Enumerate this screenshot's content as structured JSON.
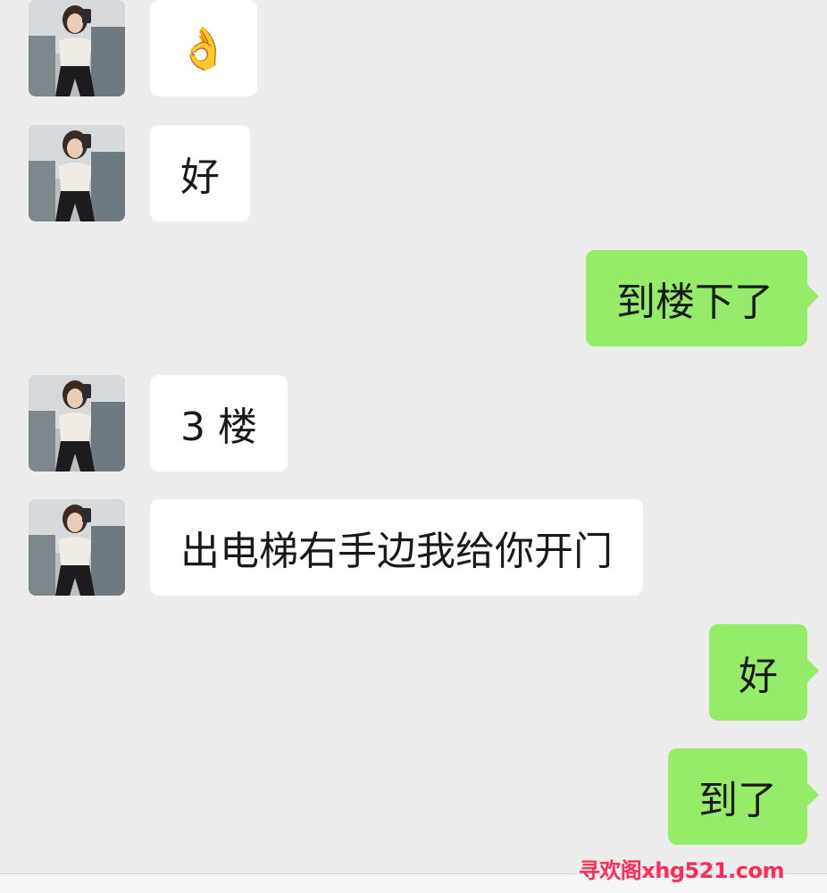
{
  "colors": {
    "background": "#ededed",
    "incoming_bubble": "#ffffff",
    "outgoing_bubble": "#95ec69",
    "text": "#191919",
    "watermark": "#ff2d55"
  },
  "messages": [
    {
      "direction": "incoming",
      "avatar": "contact-avatar-photo",
      "text": "👌"
    },
    {
      "direction": "incoming",
      "avatar": "contact-avatar-photo",
      "text": "好"
    },
    {
      "direction": "outgoing",
      "text": "到楼下了"
    },
    {
      "direction": "incoming",
      "avatar": "contact-avatar-photo",
      "text": "3 楼"
    },
    {
      "direction": "incoming",
      "avatar": "contact-avatar-photo",
      "text": "出电梯右手边我给你开门"
    },
    {
      "direction": "outgoing",
      "text": "好"
    },
    {
      "direction": "outgoing",
      "text": "到了"
    }
  ],
  "watermark": "寻欢阁xhg521.com"
}
